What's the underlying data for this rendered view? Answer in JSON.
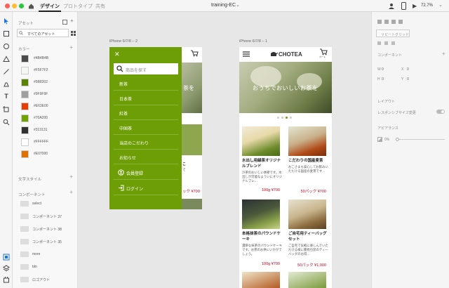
{
  "titlebar": {
    "tabs": [
      "デザイン",
      "プロトタイプ",
      "共有"
    ],
    "doc_title": "training-EC",
    "doc_chevron": "⌄",
    "zoom": "72.7%",
    "zoom_chevron": "⌄"
  },
  "left": {
    "assets_label": "アセット",
    "filter_label": "すべてのアセット",
    "colors_label": "カラー",
    "colors": [
      {
        "hex": "#4B4B4B",
        "label": "#4B4B4B"
      },
      {
        "hex": "#F5F7F2",
        "label": "#F5F7F2"
      },
      {
        "hex": "#5B8302",
        "label": "#5B8302"
      },
      {
        "hex": "#9F9F9F",
        "label": "#9F9F9F"
      },
      {
        "hex": "#E63E00",
        "label": "#E63E00"
      },
      {
        "hex": "#70A200",
        "label": "#70A200"
      },
      {
        "hex": "#313131",
        "label": "#313131"
      },
      {
        "hex": "#FFFFFF",
        "label": "#FFFFFF"
      },
      {
        "hex": "#E07000",
        "label": "#E07000"
      }
    ],
    "char_styles_label": "文字スタイル",
    "components_label": "コンポーネント",
    "components": [
      "select",
      "コンポーネント 37",
      "コンポーネント 38",
      "コンポーネント 35",
      "more",
      "btn",
      "ロゴアウト"
    ]
  },
  "canvas": {
    "artboard2_label": "iPhone 6/7/8 – 2",
    "artboard1_label": "iPhone 6/7/8 – 1",
    "menu": {
      "close": "✕",
      "search_placeholder": "商品を探す",
      "items": [
        "新茶",
        "日本茶",
        "紅茶",
        "中国茶",
        "当店のこだわり",
        "お知らせ"
      ],
      "login_items": [
        "会員登録",
        "ログイン"
      ]
    },
    "art2_bg": {
      "price1": "ック ¥700",
      "price2": "ック ¥700",
      "text1": "こ",
      "text2": "で"
    },
    "site": {
      "logo": "CHOTEA",
      "cart_label": "カート",
      "hero_text": "おうちでおいしいお茶を",
      "products": [
        {
          "title": "水出し用緑茶オリジナルブレンド",
          "desc": "冷茶のおいしい季節です。水出しが可能なよういにオリジナルブレ…",
          "qty": "100g",
          "price": "¥700"
        },
        {
          "title": "こだわりの国産麦茶",
          "desc": "おこさまも安心してお飲みいただける国産の麦茶です…",
          "qty": "50パック",
          "price": "¥700"
        },
        {
          "title": "本格抹茶のパウンドケーキ",
          "desc": "濃厚な抹茶のパウンドケーキです。お茶のお供にいかがでしょう。",
          "qty": "100g",
          "price": "¥700"
        },
        {
          "title": "ご自宅用ティーバッグセット",
          "desc": "ご自宅で気軽に楽しんでいただける様に簡易包装のティーバッグのお得…",
          "qty": "50パック",
          "price": "¥1,000"
        }
      ]
    }
  },
  "right": {
    "repeat_grid": "リピートグリッド",
    "component_label": "コンポーネント",
    "w_label": "W",
    "w_value": "0",
    "x_label": "X",
    "x_value": "0",
    "h_label": "H",
    "h_value": "0",
    "y_label": "Y",
    "y_value": "0",
    "layout_label": "レイアウト",
    "responsive_label": "レスポンシブサイズ変更",
    "appearance_label": "アピアランス",
    "opacity": "0%"
  }
}
